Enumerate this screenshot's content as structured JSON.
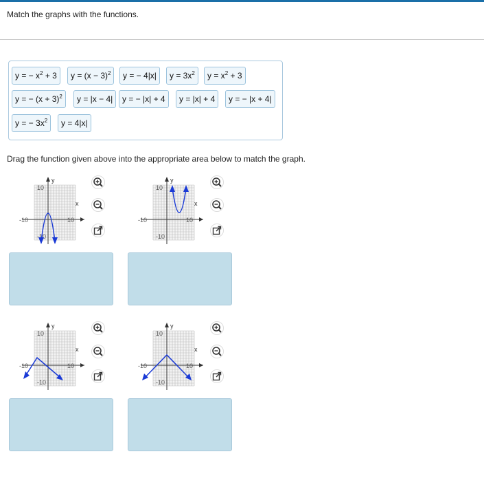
{
  "prompt": "Match the graphs with the functions.",
  "instruction": "Drag the function given above into the appropriate area below to match the graph.",
  "functions": [
    {
      "lead": "y = − x",
      "exp": "2",
      "tail": " + 3"
    },
    {
      "lead": "y = (x − 3)",
      "exp": "2",
      "tail": ""
    },
    {
      "lead": "y = − 4|x|",
      "exp": "",
      "tail": ""
    },
    {
      "lead": "y = 3x",
      "exp": "2",
      "tail": ""
    },
    {
      "lead": "y = x",
      "exp": "2",
      "tail": " + 3"
    },
    {
      "lead": "y = − (x + 3)",
      "exp": "2",
      "tail": ""
    },
    {
      "lead": "y = |x − 4|",
      "exp": "",
      "tail": ""
    },
    {
      "lead": "y = − |x| + 4",
      "exp": "",
      "tail": ""
    },
    {
      "lead": "y = |x| + 4",
      "exp": "",
      "tail": ""
    },
    {
      "lead": "y = − |x + 4|",
      "exp": "",
      "tail": ""
    },
    {
      "lead": "y = − 3x",
      "exp": "2",
      "tail": ""
    },
    {
      "lead": "y = 4|x|",
      "exp": "",
      "tail": ""
    }
  ],
  "axes": {
    "y_label": "y",
    "x_label": "x",
    "pos": "10",
    "neg": "-10"
  },
  "graphs": [
    {
      "function": "y = − 3x^2",
      "shape": "downward parabola, vertex (0,0)"
    },
    {
      "function": "y = 3x^2",
      "shape": "upward parabola, vertex (0,0)"
    },
    {
      "function": "y = − |x + 4|",
      "shape": "inverted V, vertex (-4,0)"
    },
    {
      "function": "y = − |x| + 4",
      "shape": "inverted V, vertex (0,4)"
    }
  ],
  "tool_icons": [
    "zoom-in-icon",
    "zoom-out-icon",
    "open-window-icon"
  ],
  "colors": {
    "curve": "#1a3ad6",
    "accent": "#1a6fa8",
    "drop_zone": "#c1dde9"
  }
}
